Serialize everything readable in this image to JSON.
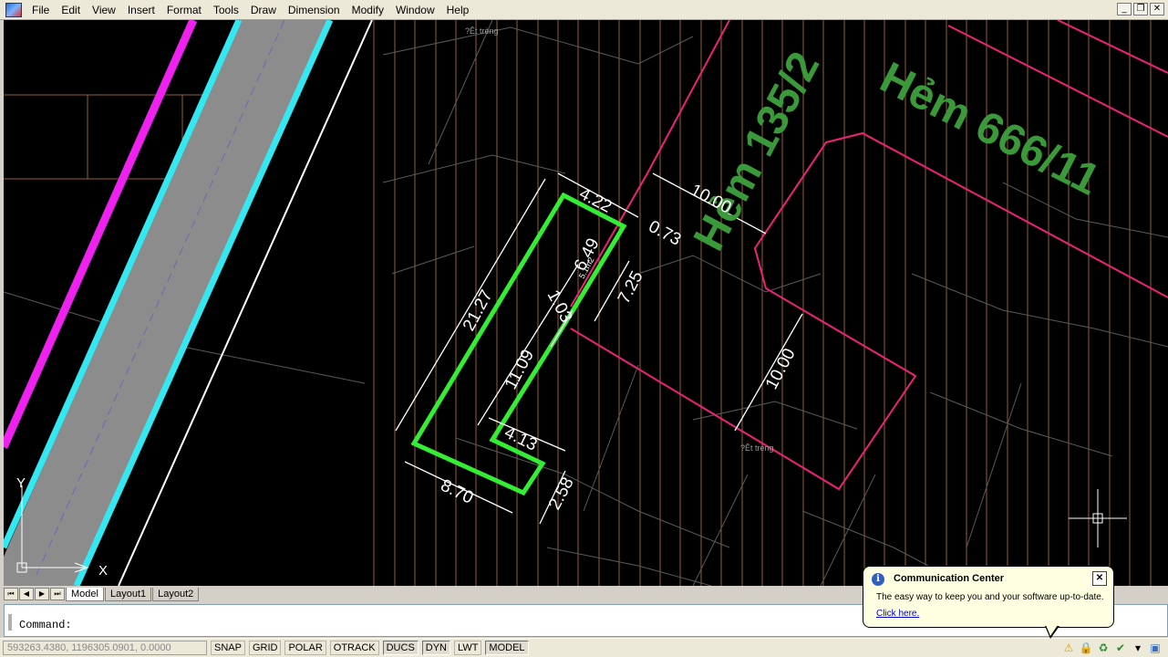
{
  "menu": {
    "items": [
      "File",
      "Edit",
      "View",
      "Insert",
      "Format",
      "Tools",
      "Draw",
      "Dimension",
      "Modify",
      "Window",
      "Help"
    ]
  },
  "drawing": {
    "street_labels": [
      "Hẻm 135/2",
      "Hẻm 666/11"
    ],
    "dimensions": [
      "4.22",
      "0.73",
      "10.00",
      "6.49",
      "7.25",
      "1.03",
      "21.27",
      "11.09",
      "4.13",
      "8.70",
      "2.58",
      "10.00"
    ],
    "small_labels": [
      "?Êt trèng",
      "?Êt trèng",
      "5.1m2"
    ],
    "ucs": {
      "x": "X",
      "y": "Y"
    }
  },
  "tabs": [
    "Model",
    "Layout1",
    "Layout2"
  ],
  "command": {
    "prompt": "Command:"
  },
  "status": {
    "coords": "593263.4380, 1196305.0901, 0.0000",
    "toggles": [
      {
        "label": "SNAP",
        "on": false
      },
      {
        "label": "GRID",
        "on": false
      },
      {
        "label": "POLAR",
        "on": false
      },
      {
        "label": "OTRACK",
        "on": false
      },
      {
        "label": "DUCS",
        "on": true
      },
      {
        "label": "DYN",
        "on": true
      },
      {
        "label": "LWT",
        "on": false
      },
      {
        "label": "MODEL",
        "on": true
      }
    ]
  },
  "notification": {
    "title": "Communication Center",
    "body": "The easy way to keep you and your software up-to-date.",
    "link": "Click here."
  },
  "colors": {
    "parcel": "#33ee33",
    "road_cyan": "#33e8f0",
    "road_magenta": "#ee22ee",
    "boundary": "#ee2277",
    "street_text": "#3a9a3a",
    "grid_lines": "#b07040"
  }
}
